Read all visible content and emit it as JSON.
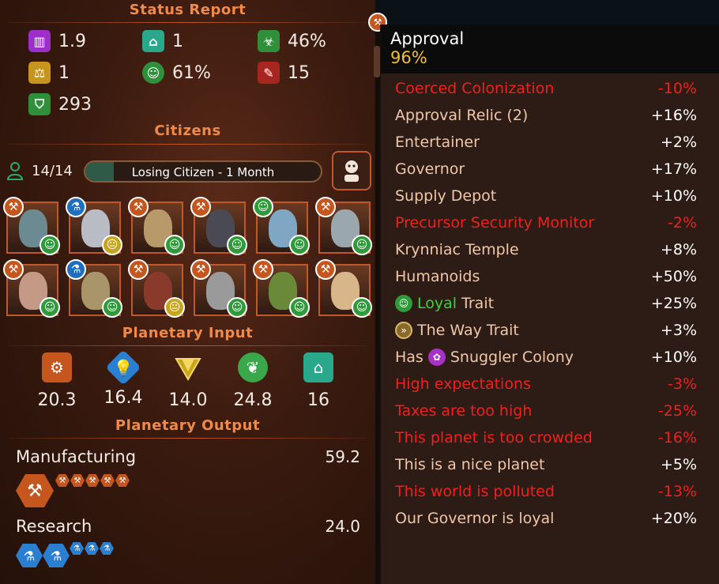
{
  "status_report": {
    "title": "Status Report",
    "stats": [
      {
        "icon": "building-icon",
        "value": "1.9",
        "color": "#9c2fc9"
      },
      {
        "icon": "depot-icon",
        "value": "1",
        "color": "#2aa88c"
      },
      {
        "icon": "biohazard-icon",
        "value": "46%",
        "color": "#2f8f3a"
      },
      {
        "icon": "scales-icon",
        "value": "1",
        "color": "#c7951d"
      },
      {
        "icon": "smile-icon",
        "value": "61%",
        "color": "#2f8f3a"
      },
      {
        "icon": "wrench-icon",
        "value": "15",
        "color": "#a8261f"
      },
      {
        "icon": "shield-icon",
        "value": "293",
        "color": "#2f8f3a"
      }
    ]
  },
  "citizens": {
    "title": "Citizens",
    "count": "14/14",
    "progress_label": "Losing Citizen - 1 Month",
    "progress_fraction": 0.12,
    "portraits": [
      {
        "role": "hammer",
        "mood": "happy",
        "skin": "#6c8a92"
      },
      {
        "role": "flask",
        "mood": "neutral",
        "skin": "#b9bcc4"
      },
      {
        "role": "hammer",
        "mood": "happy",
        "skin": "#b89a6a"
      },
      {
        "role": "hammer",
        "mood": "happy",
        "skin": "#4a4a55"
      },
      {
        "role": "smile",
        "mood": "happy",
        "skin": "#7fa7c4"
      },
      {
        "role": "hammer",
        "mood": "happy",
        "skin": "#9aa7ad"
      },
      {
        "role": "hammer",
        "mood": "happy",
        "skin": "#c49a86"
      },
      {
        "role": "flask",
        "mood": "happy",
        "skin": "#a8966a"
      },
      {
        "role": "hammer",
        "mood": "neutral",
        "skin": "#8a3a2a"
      },
      {
        "role": "hammer",
        "mood": "happy",
        "skin": "#9a9a9a"
      },
      {
        "role": "hammer",
        "mood": "happy",
        "skin": "#6a8a3a"
      },
      {
        "role": "hammer",
        "mood": "happy",
        "skin": "#d8b68a"
      }
    ]
  },
  "planetary_input": {
    "title": "Planetary Input",
    "items": [
      {
        "icon": "gear-icon",
        "value": "20.3",
        "color": "#c4561e"
      },
      {
        "icon": "bulb-icon",
        "value": "16.4",
        "color": "#2a7fd0"
      },
      {
        "icon": "diamond-icon",
        "value": "14.0",
        "color": "#c7a51d"
      },
      {
        "icon": "leaf-icon",
        "value": "24.8",
        "color": "#3aa84a"
      },
      {
        "icon": "depot-icon",
        "value": "16",
        "color": "#2aa88c"
      }
    ]
  },
  "planetary_output": {
    "title": "Planetary Output",
    "manufacturing": {
      "label": "Manufacturing",
      "value": "59.2"
    },
    "research": {
      "label": "Research",
      "value": "24.0"
    }
  },
  "approval": {
    "title": "Approval",
    "value": "96%",
    "modifiers": [
      {
        "name": "Coerced Colonization",
        "value": "-10%",
        "type": "neg"
      },
      {
        "name": "Approval Relic (2)",
        "value": "+16%",
        "type": "pos"
      },
      {
        "name": "Entertainer",
        "value": "+2%",
        "type": "pos"
      },
      {
        "name": "Governor",
        "value": "+17%",
        "type": "pos"
      },
      {
        "name": "Supply Depot",
        "value": "+10%",
        "type": "pos"
      },
      {
        "name": "Precursor Security Monitor",
        "value": "-2%",
        "type": "neg"
      },
      {
        "name": "Krynniac Temple",
        "value": "+8%",
        "type": "pos"
      },
      {
        "name": "Humanoids",
        "value": "+50%",
        "type": "pos"
      },
      {
        "name": "Trait",
        "value": "+25%",
        "type": "pos",
        "icon": "loyal-icon",
        "prefix": "Loyal"
      },
      {
        "name": "The Way Trait",
        "value": "+3%",
        "type": "pos",
        "icon": "the-way-icon"
      },
      {
        "name": "Snuggler Colony",
        "value": "+10%",
        "type": "pos",
        "icon": "snuggler-icon",
        "prefix": "Has"
      },
      {
        "name": "High expectations",
        "value": "-3%",
        "type": "neg"
      },
      {
        "name": "Taxes are too high",
        "value": "-25%",
        "type": "neg"
      },
      {
        "name": "This planet is too crowded",
        "value": "-16%",
        "type": "neg"
      },
      {
        "name": "This is a nice planet",
        "value": "+5%",
        "type": "pos"
      },
      {
        "name": "This world is polluted",
        "value": "-13%",
        "type": "neg"
      },
      {
        "name": "Our Governor is loyal",
        "value": "+20%",
        "type": "pos"
      }
    ]
  }
}
